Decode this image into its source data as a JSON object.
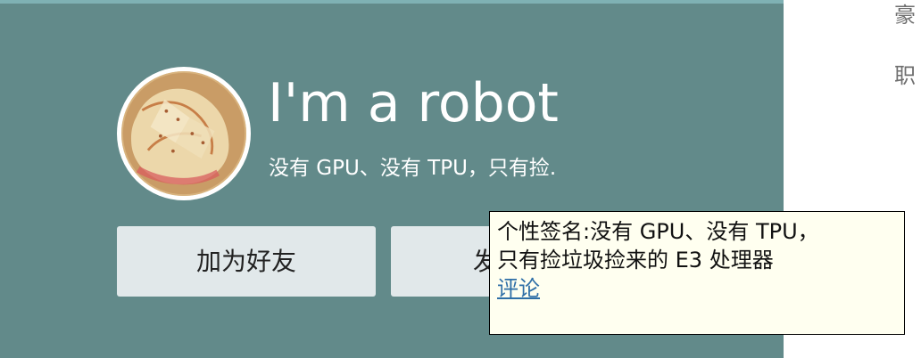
{
  "profile": {
    "username": "I'm a robot",
    "signature": "没有 GPU、没有 TPU，只有捡.",
    "buttons": {
      "add_friend": "加为好友",
      "second_action": "发"
    },
    "avatar_icon": "food-avatar-icon"
  },
  "tooltip": {
    "line_1": "个性签名:没有 GPU、没有 TPU，",
    "line_2": "只有捡垃圾捡来的 E3 处理器",
    "link_label": "评论"
  },
  "side_text": {
    "line_1": "豪",
    "line_2": "职"
  },
  "colors": {
    "card_background": "#628a8a",
    "card_top_strip": "#7fb1b4",
    "button_background": "#e1e8ea",
    "tooltip_background": "#fffff0",
    "link_color": "#2f6fa7"
  }
}
